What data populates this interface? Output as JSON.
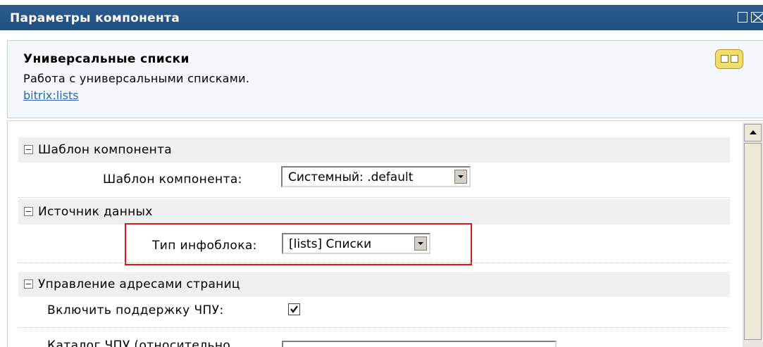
{
  "window": {
    "title": "Параметры компонента"
  },
  "component": {
    "name": "Универсальные списки",
    "description": "Работа с универсальными списками.",
    "code": "bitrix:lists"
  },
  "sections": [
    {
      "label": "Шаблон компонента",
      "params": [
        {
          "label": "Шаблон компонента:",
          "value": "Системный: .default"
        }
      ]
    },
    {
      "label": "Источник данных",
      "params": [
        {
          "label": "Тип инфоблока:",
          "value": "[lists] Списки"
        }
      ]
    },
    {
      "label": "Управление адресами страниц",
      "params": [
        {
          "label": "Включить поддержку ЧПУ:",
          "checked": true
        },
        {
          "label": "Каталог ЧПУ (относительно",
          "value": ""
        }
      ]
    }
  ],
  "colors": {
    "titlebar": "#1f4f82",
    "link": "#2b68a8",
    "highlight": "#e01818"
  },
  "icons": {
    "component_icon": "component-blocks-icon",
    "expand_toggle": "minus-box-icon"
  }
}
